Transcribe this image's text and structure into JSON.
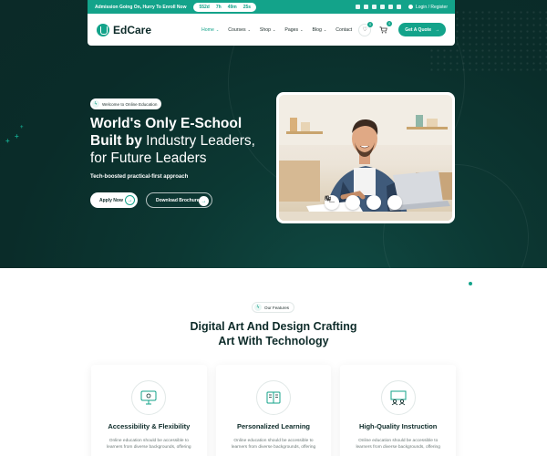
{
  "topbar": {
    "promo": "Admission Going On, Hurry To Enroll Now",
    "countdown": [
      "552d",
      "7h",
      "49m",
      "25s"
    ],
    "login": "Login / Register"
  },
  "nav": {
    "logo": "EdCare",
    "items": [
      {
        "label": "Home",
        "active": true,
        "has_dropdown": true
      },
      {
        "label": "Courses",
        "has_dropdown": true
      },
      {
        "label": "Shop",
        "has_dropdown": true
      },
      {
        "label": "Pages",
        "has_dropdown": true
      },
      {
        "label": "Blog",
        "has_dropdown": true
      },
      {
        "label": "Contact",
        "has_dropdown": false
      }
    ],
    "wishlist_count": "0",
    "cart_count": "0",
    "cta": "Get A Quote"
  },
  "hero": {
    "tag": "Welcome to Online Education",
    "title_bold_1": "World's Only E-School",
    "title_bold_2": "Built by",
    "title_rest_2": " Industry Leaders,",
    "title_line_3": "for Future Leaders",
    "subtitle": "Tech-boosted practical-first approach",
    "apply_label": "Apply Now",
    "brochure_label": "Download Brochure",
    "video_controls": [
      "minus-icon",
      "mic-off-icon",
      "phone-icon",
      "video-icon"
    ]
  },
  "features": {
    "tag": "Our Features",
    "title_line_1": "Digital Art And Design Crafting",
    "title_line_2": "Art With Technology",
    "cards": [
      {
        "title": "Accessibility & Flexibility",
        "desc": "Online education should be accessible to learners from diverse backgrounds, offering",
        "icon": "monitor-icon"
      },
      {
        "title": "Personalized Learning",
        "desc": "Online education should be accessible to learners from diverse backgrounds, offering",
        "icon": "book-icon"
      },
      {
        "title": "High-Quality Instruction",
        "desc": "Online education should be accessible to learners from diverse backgrounds, offering",
        "icon": "teacher-icon"
      }
    ]
  },
  "colors": {
    "accent": "#13a38a",
    "hero_bg": "#0b2e2b",
    "heading": "#0d2b29"
  }
}
